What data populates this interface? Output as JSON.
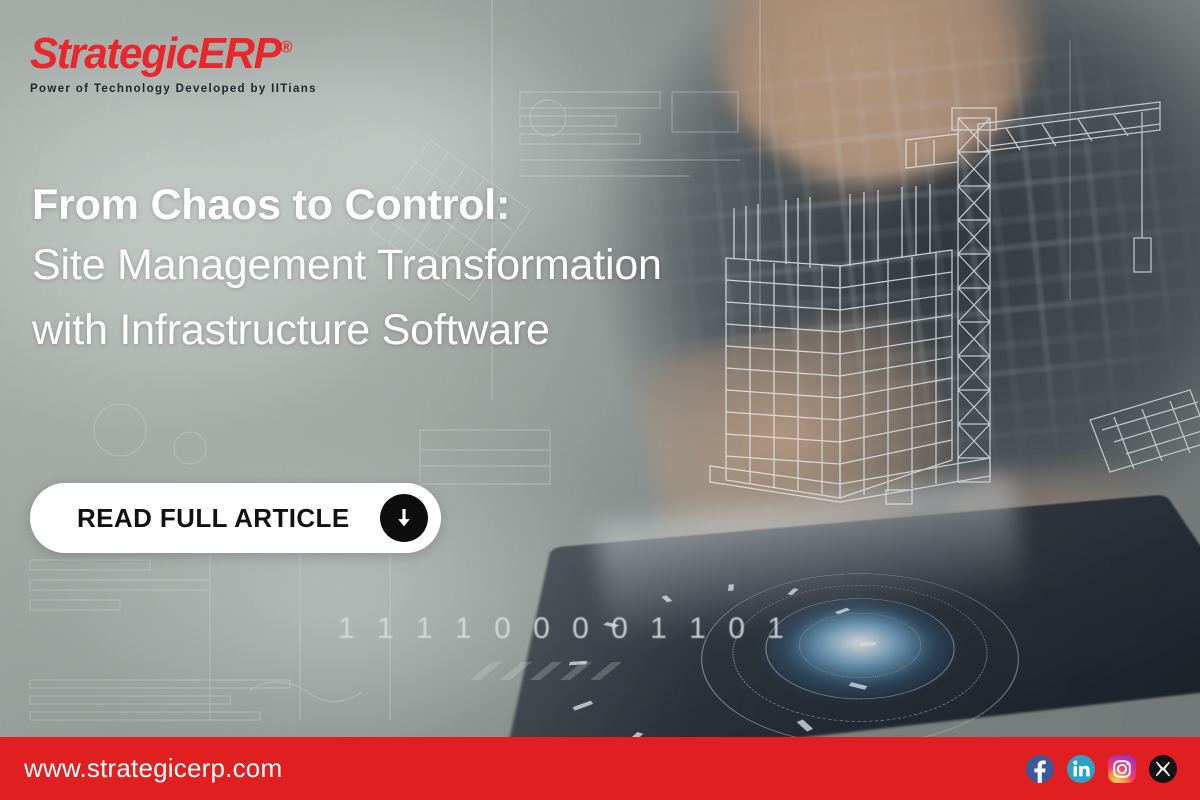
{
  "brand": {
    "logo_text": "StrategicERP",
    "logo_registered_mark": "®",
    "tagline": "Power of Technology Developed by IITians",
    "logo_color": "#e8262b",
    "footer_color": "#e01f20"
  },
  "headline": {
    "line1": "From Chaos to Control:",
    "line2": "Site Management Transformation",
    "line3": "with Infrastructure Software"
  },
  "cta": {
    "label": "READ FULL ARTICLE",
    "icon": "arrow-down-circle-icon"
  },
  "background": {
    "binary_overlay": "1 1 1 1 0 0 0 0 1 1 0 1",
    "scene_description": "construction professional using tablet with wireframe building and tower crane hologram"
  },
  "footer": {
    "url": "www.strategicerp.com",
    "socials": [
      {
        "name": "facebook",
        "label": "f",
        "color": "#3b5998"
      },
      {
        "name": "linkedin",
        "label": "in",
        "color": "#2aa3c7"
      },
      {
        "name": "instagram",
        "label": "",
        "color": "#e1306c"
      },
      {
        "name": "x-twitter",
        "label": "X",
        "color": "#111111"
      }
    ]
  }
}
